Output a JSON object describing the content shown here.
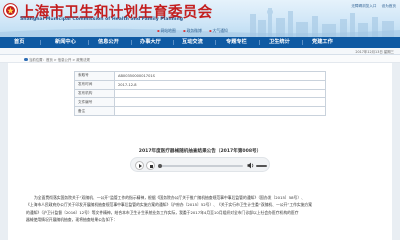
{
  "header": {
    "title": "上海市卫生和计划生育委员会",
    "subtitle": "Shanghai Municipal Commission of Health and Family Planning",
    "util_links": [
      "无障碍浏览入口",
      "设为首页"
    ],
    "mini_links": [
      "网站地图",
      "政务微博",
      "大气通知"
    ]
  },
  "nav": {
    "items": [
      "首页",
      "新闻中心",
      "信息公开",
      "办事大厅",
      "互动交流",
      "专题专栏",
      "卫生统计",
      "党建工作"
    ]
  },
  "subbar": {
    "weather": "",
    "date": "2017年12月13日 星期三"
  },
  "breadcrumb": "当前位置：首页 > 信息公开 > 政策法规",
  "meta": {
    "rows": [
      {
        "key": "索取号",
        "value": "AB0035000001701S"
      },
      {
        "key": "发布时间",
        "value": "2017-12-8"
      },
      {
        "key": "发布机构",
        "value": ""
      },
      {
        "key": "文件编号",
        "value": ""
      },
      {
        "key": "备注",
        "value": ""
      }
    ]
  },
  "doc": {
    "title": "2017年度医疗器械随机抽查结果公告（2017年第008号）"
  },
  "player": {
    "progress": 0,
    "volume": 1
  },
  "body": {
    "lines": [
      "为全面贯彻落实国务院关于“双随机、一公开”监管工作的指示精神，根据《国务院办公厅关于推广随机抽查规范事中事后监管的通知》（国办发〔2015〕58号）、",
      "《上海市人民政府办公厅关于印发开展随机抽查规范事中事后监管的实施方案的通知》（沪府办〔2015〕52号）、《关于实行市卫生计生委“双随机、一公开”工作实施方案",
      "的通知》（沪卫计监督〔2016〕12号）等文件精神，结合本市卫生计生系统业务工作实际，我委于2017年4月至10月组织对全市门诊部以上社会办医疗机构的医疗",
      "器械使用情况开展随机抽查，现将抽查结果公告如下："
    ]
  },
  "colors": {
    "title_red": "#c41d1d",
    "nav_blue": "#0f5aa3",
    "link_blue": "#2a5d8f"
  }
}
